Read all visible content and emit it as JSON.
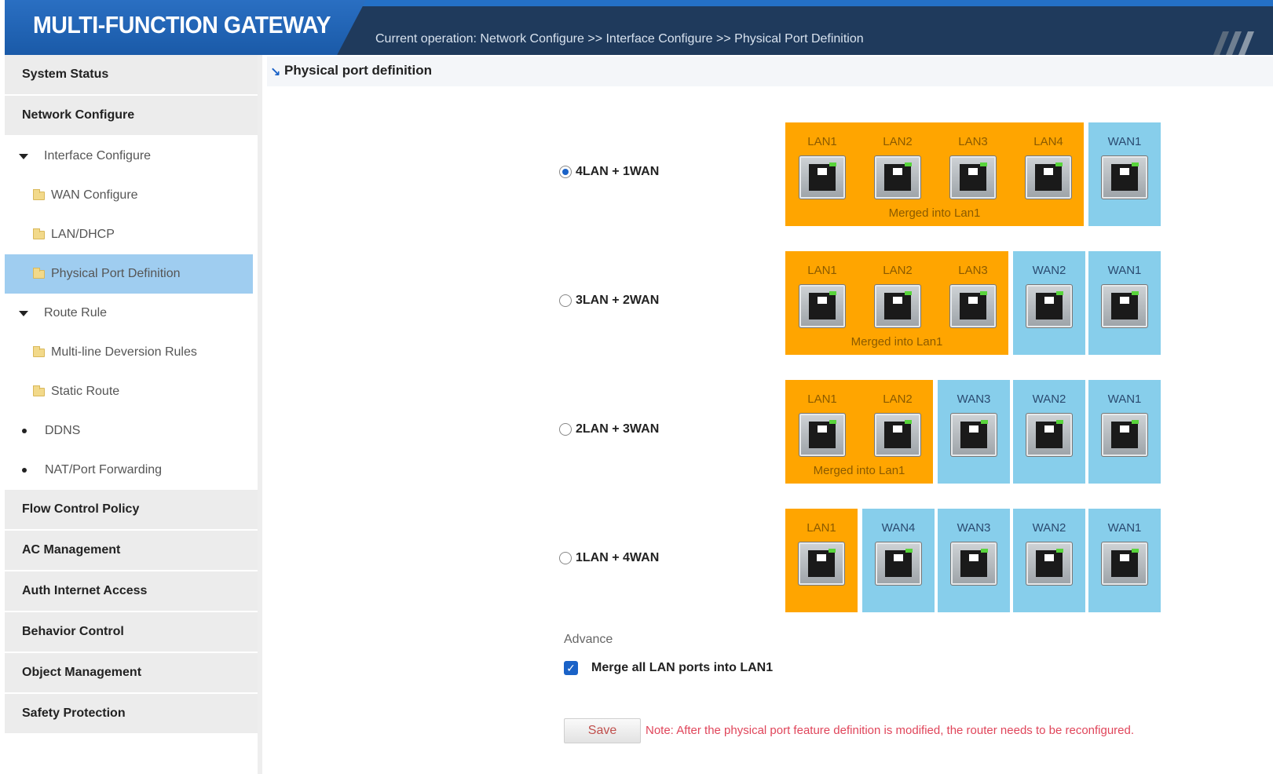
{
  "header": {
    "logo": "MULTI-FUNCTION GATEWAY",
    "breadcrumb": "Current operation: Network Configure >> Interface Configure >> Physical Port Definition"
  },
  "sidebar": {
    "system_status": "System Status",
    "network_configure": "Network Configure",
    "interface_configure": "Interface Configure",
    "wan_configure": "WAN Configure",
    "lan_dhcp": "LAN/DHCP",
    "physical_port_definition": "Physical Port Definition",
    "route_rule": "Route Rule",
    "multiline_rules": "Multi-line Deversion Rules",
    "static_route": "Static Route",
    "ddns": "DDNS",
    "nat_forwarding": "NAT/Port Forwarding",
    "flow_control": "Flow Control Policy",
    "ac_management": "AC Management",
    "auth_internet": "Auth Internet Access",
    "behavior_control": "Behavior Control",
    "object_management": "Object Management",
    "safety_protection": "Safety Protection"
  },
  "content": {
    "title": "Physical port definition",
    "merged_text": "Merged into Lan1",
    "options": [
      {
        "label": "4LAN + 1WAN",
        "selected": true
      },
      {
        "label": "3LAN + 2WAN",
        "selected": false
      },
      {
        "label": "2LAN + 3WAN",
        "selected": false
      },
      {
        "label": "1LAN + 4WAN",
        "selected": false
      }
    ],
    "rows": [
      [
        "LAN1",
        "LAN2",
        "LAN3",
        "LAN4",
        "WAN1"
      ],
      [
        "LAN1",
        "LAN2",
        "LAN3",
        "WAN2",
        "WAN1"
      ],
      [
        "LAN1",
        "LAN2",
        "WAN3",
        "WAN2",
        "WAN1"
      ],
      [
        "LAN1",
        "WAN4",
        "WAN3",
        "WAN2",
        "WAN1"
      ]
    ],
    "advance_label": "Advance",
    "merge_checkbox_label": "Merge all LAN ports into LAN1",
    "merge_checked": true,
    "save_label": "Save",
    "note": "Note: After the physical port feature definition is modified, the router needs to be reconfigured."
  },
  "colors": {
    "lan_block": "#ffa500",
    "wan_block": "#87ceeb",
    "header_bg": "#1f3a5c",
    "brand_blue": "#1a5aa8",
    "active_menu": "#9fcdf0",
    "note_red": "#e0455a"
  }
}
